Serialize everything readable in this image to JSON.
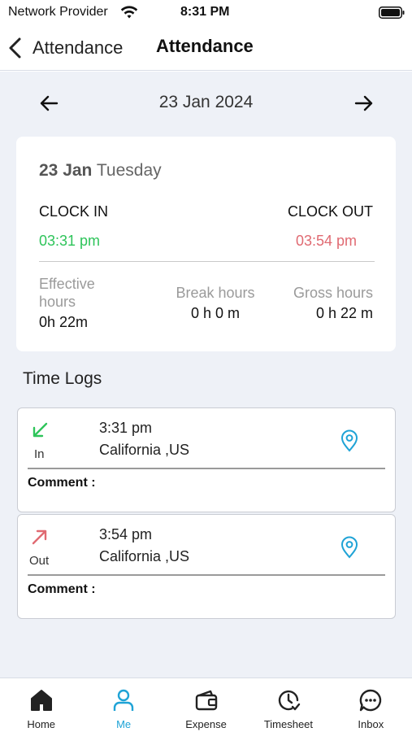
{
  "status_bar": {
    "carrier": "Network Provider",
    "time": "8:31 PM"
  },
  "nav": {
    "back_label": "Attendance",
    "title": "Attendance"
  },
  "date_nav": {
    "date": "23 Jan 2024"
  },
  "summary": {
    "date": "23 Jan",
    "day": "Tuesday",
    "clock_in_label": "CLOCK IN",
    "clock_out_label": "CLOCK OUT",
    "clock_in_time": "03:31 pm",
    "clock_out_time": "03:54 pm",
    "effective_label": "Effective hours",
    "effective_value": "0h 22m",
    "break_label": "Break hours",
    "break_value": "0 h 0 m",
    "gross_label": "Gross hours",
    "gross_value": "0 h 22 m"
  },
  "time_logs": {
    "title": "Time Logs",
    "entries": [
      {
        "direction": "In",
        "time": "3:31 pm",
        "location": "California ,US",
        "comment_label": "Comment :",
        "icon": "arrow-down-left-icon"
      },
      {
        "direction": "Out",
        "time": "3:54 pm",
        "location": "California ,US",
        "comment_label": "Comment :",
        "icon": "arrow-up-right-icon"
      }
    ]
  },
  "tabs": [
    {
      "label": "Home",
      "icon": "home-icon"
    },
    {
      "label": "Me",
      "icon": "person-icon"
    },
    {
      "label": "Expense",
      "icon": "wallet-icon"
    },
    {
      "label": "Timesheet",
      "icon": "clock-check-icon"
    },
    {
      "label": "Inbox",
      "icon": "chat-icon"
    }
  ],
  "colors": {
    "clock_in": "#2ec45a",
    "clock_out": "#e06a72",
    "accent": "#1fa3d6",
    "background": "#eef1f7"
  }
}
